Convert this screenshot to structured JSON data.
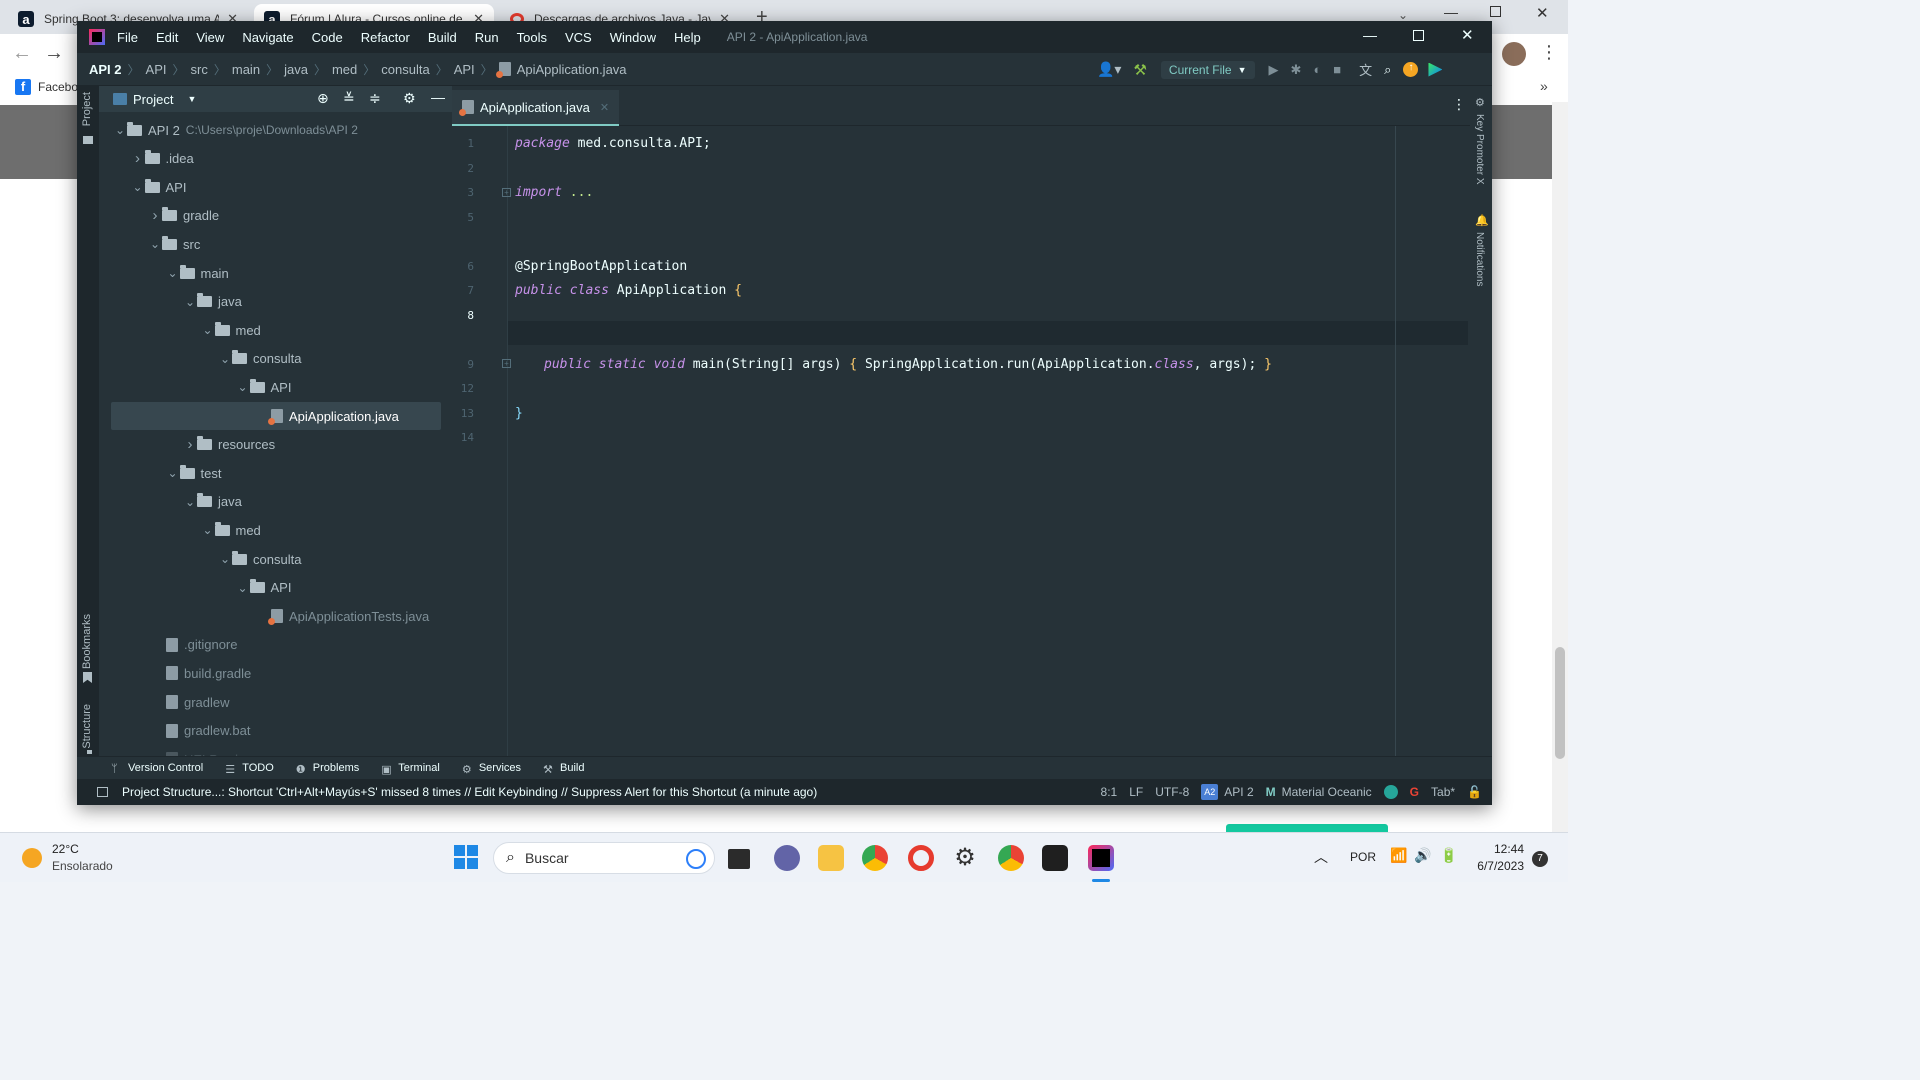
{
  "browser": {
    "tabs": [
      {
        "label": "Spring Boot 3: desenvolva uma A",
        "fav": "a",
        "fav_bg": "#0d1c2e",
        "fav_color": "#ffffff"
      },
      {
        "label": "Fórum | Alura - Cursos online de",
        "fav": "a",
        "fav_bg": "#0d1c2e",
        "fav_color": "#ffffff"
      },
      {
        "label": "Descargas de archivos Java - Jav",
        "fav": "",
        "fav_bg": "#e63b2e",
        "fav_color": "#ffffff"
      }
    ],
    "bookmark": "Facebo",
    "more_label": "»"
  },
  "ide": {
    "menu": [
      "File",
      "Edit",
      "View",
      "Navigate",
      "Code",
      "Refactor",
      "Build",
      "Run",
      "Tools",
      "VCS",
      "Window",
      "Help"
    ],
    "window_title": "API 2 - ApiApplication.java",
    "breadcrumbs": [
      "API 2",
      "API",
      "src",
      "main",
      "java",
      "med",
      "consulta",
      "API",
      "ApiApplication.java"
    ],
    "run_config": "Current File",
    "project_label": "Project",
    "left_stripe": {
      "project": "Project",
      "bookmarks": "Bookmarks",
      "structure": "Structure"
    },
    "right_stripe": {
      "key_promoter": "Key Promoter X",
      "notifications": "Notifications"
    },
    "tree": [
      {
        "label": "API 2",
        "extra": "C:\\Users\\proje\\Downloads\\API 2",
        "indent": 0,
        "chev": "v",
        "icon": "folder"
      },
      {
        "label": ".idea",
        "indent": 1,
        "chev": ">",
        "icon": "folder"
      },
      {
        "label": "API",
        "indent": 1,
        "chev": "v",
        "icon": "folder"
      },
      {
        "label": "gradle",
        "indent": 2,
        "chev": ">",
        "icon": "folder"
      },
      {
        "label": "src",
        "indent": 2,
        "chev": "v",
        "icon": "folder"
      },
      {
        "label": "main",
        "indent": 3,
        "chev": "v",
        "icon": "folder"
      },
      {
        "label": "java",
        "indent": 4,
        "chev": "v",
        "icon": "folder"
      },
      {
        "label": "med",
        "indent": 5,
        "chev": "v",
        "icon": "folder"
      },
      {
        "label": "consulta",
        "indent": 6,
        "chev": "v",
        "icon": "folder"
      },
      {
        "label": "API",
        "indent": 7,
        "chev": "v",
        "icon": "folder"
      },
      {
        "label": "ApiApplication.java",
        "indent": 8,
        "chev": "",
        "icon": "java",
        "selected": true
      },
      {
        "label": "resources",
        "indent": 4,
        "chev": ">",
        "icon": "folder"
      },
      {
        "label": "test",
        "indent": 3,
        "chev": "v",
        "icon": "folder"
      },
      {
        "label": "java",
        "indent": 4,
        "chev": "v",
        "icon": "folder"
      },
      {
        "label": "med",
        "indent": 5,
        "chev": "v",
        "icon": "folder"
      },
      {
        "label": "consulta",
        "indent": 6,
        "chev": "v",
        "icon": "folder"
      },
      {
        "label": "API",
        "indent": 7,
        "chev": "v",
        "icon": "folder"
      },
      {
        "label": "ApiApplicationTests.java",
        "indent": 8,
        "chev": "",
        "icon": "java",
        "dim": true
      },
      {
        "label": ".gitignore",
        "indent": 2,
        "chev": "",
        "icon": "file",
        "dim": true
      },
      {
        "label": "build.gradle",
        "indent": 2,
        "chev": "",
        "icon": "file",
        "dim": true
      },
      {
        "label": "gradlew",
        "indent": 2,
        "chev": "",
        "icon": "file",
        "dim": true
      },
      {
        "label": "gradlew.bat",
        "indent": 2,
        "chev": "",
        "icon": "file",
        "dim": true
      },
      {
        "label": "HELP.md",
        "indent": 2,
        "chev": "",
        "icon": "file",
        "dim": true
      }
    ],
    "editor_tab": "ApiApplication.java",
    "code": {
      "line_numbers": [
        "1",
        "2",
        "3",
        "5",
        "6",
        "7",
        "8",
        "9",
        "12",
        "13",
        "14"
      ],
      "package_kw": "package",
      "package_name": "med.consulta.API;",
      "import_kw": "import",
      "import_dots": "...",
      "annotation": "@SpringBootApplication",
      "public_kw": "public",
      "class_kw": "class",
      "class_name": "ApiApplication",
      "open_brace": "{",
      "static_kw": "static",
      "void_kw": "void",
      "main_sig": "main(String[] args)",
      "body_open": "{",
      "body_call": "SpringApplication.run(ApiApplication.",
      "class_literal": "class",
      "body_args": ", args);",
      "body_close": "}",
      "close_brace": "}"
    },
    "tool_tabs": [
      "Version Control",
      "TODO",
      "Problems",
      "Terminal",
      "Services",
      "Build"
    ],
    "status": {
      "message": "Project Structure...: Shortcut 'Ctrl+Alt+Mayús+S' missed 8 times // Edit Keybinding // Suppress Alert for this Shortcut (a minute ago)",
      "position": "8:1",
      "line_sep": "LF",
      "encoding": "UTF-8",
      "project_badge": "A2",
      "project": "API 2",
      "theme": "Material Oceanic",
      "indent": "Tab*"
    }
  },
  "taskbar": {
    "temp": "22°C",
    "weather": "Ensolarado",
    "search_placeholder": "Buscar",
    "lang": "POR",
    "time": "12:44",
    "date": "6/7/2023",
    "notif_count": "7"
  },
  "colors": {
    "accent": "#80cbc4",
    "ide_bg": "#263238",
    "keyword": "#c792ea"
  }
}
